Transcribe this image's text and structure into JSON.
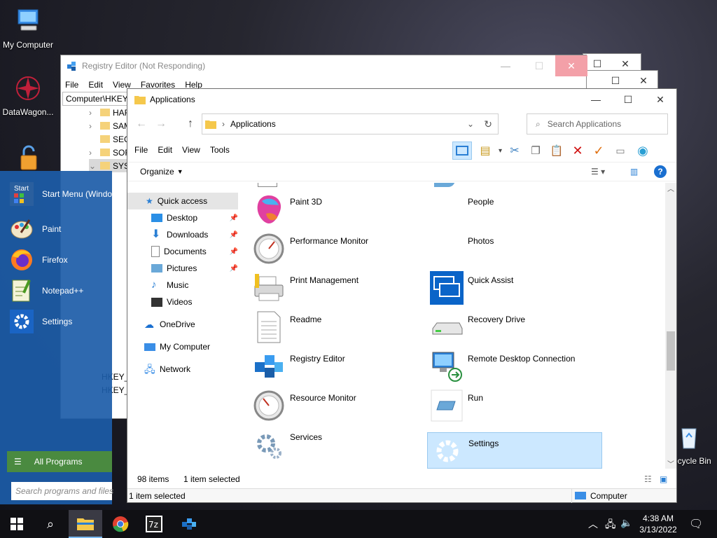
{
  "desktop": {
    "icons": [
      {
        "label": "My Computer",
        "icon": "my-computer-icon"
      },
      {
        "label": "DataWagon...",
        "icon": "datawagon-icon"
      },
      {
        "label": "Recycle Bin",
        "icon": "recycle-bin-icon"
      }
    ]
  },
  "registry": {
    "title": "Registry Editor (Not Responding)",
    "menu": [
      "File",
      "Edit",
      "View",
      "Favorites",
      "Help"
    ],
    "address": "Computer\\HKEY_",
    "tree": [
      "HAR",
      "SAM",
      "SEC",
      "SOF",
      "SYST"
    ],
    "hkeys": [
      "HKEY_",
      "HKEY_"
    ]
  },
  "explorer": {
    "title": "Applications",
    "breadcrumb": "Applications",
    "search_placeholder": "Search Applications",
    "menu": [
      "File",
      "Edit",
      "View",
      "Tools"
    ],
    "organize_label": "Organize",
    "nav": {
      "quick_access": "Quick access",
      "pinned": [
        "Desktop",
        "Downloads",
        "Documents",
        "Pictures"
      ],
      "unpinned": [
        "Music",
        "Videos"
      ],
      "onedrive": "OneDrive",
      "my_computer": "My Computer",
      "network": "Network"
    },
    "items": [
      {
        "name": "Paint 3D",
        "icon": "paint3d-icon"
      },
      {
        "name": "People",
        "icon": "people-icon"
      },
      {
        "name": "Performance Monitor",
        "icon": "performance-monitor-icon"
      },
      {
        "name": "Photos",
        "icon": "photos-icon"
      },
      {
        "name": "Print Management",
        "icon": "print-management-icon"
      },
      {
        "name": "Quick Assist",
        "icon": "quick-assist-icon"
      },
      {
        "name": "Readme",
        "icon": "readme-icon"
      },
      {
        "name": "Recovery Drive",
        "icon": "recovery-drive-icon"
      },
      {
        "name": "Registry Editor",
        "icon": "registry-editor-icon"
      },
      {
        "name": "Remote Desktop Connection",
        "icon": "remote-desktop-icon"
      },
      {
        "name": "Resource Monitor",
        "icon": "resource-monitor-icon"
      },
      {
        "name": "Run",
        "icon": "run-icon"
      },
      {
        "name": "Services",
        "icon": "services-icon"
      },
      {
        "name": "Settings",
        "icon": "settings-icon",
        "selected": true
      }
    ],
    "status_count": "98 items",
    "status_selected": "1 item selected",
    "details_status": "1 item selected",
    "details_location": "Computer"
  },
  "start_menu": {
    "header": "Start Menu (Windo",
    "items": [
      "Paint",
      "Firefox",
      "Notepad++",
      "Settings"
    ],
    "all_programs": "All Programs",
    "search_placeholder": "Search programs and files",
    "start_label": "Start"
  },
  "taskbar": {
    "time": "4:38 AM",
    "date": "3/13/2022"
  },
  "colors": {
    "selection": "#cce8ff",
    "start_blue": "#1c5ca8",
    "accent": "#0a64c8"
  }
}
